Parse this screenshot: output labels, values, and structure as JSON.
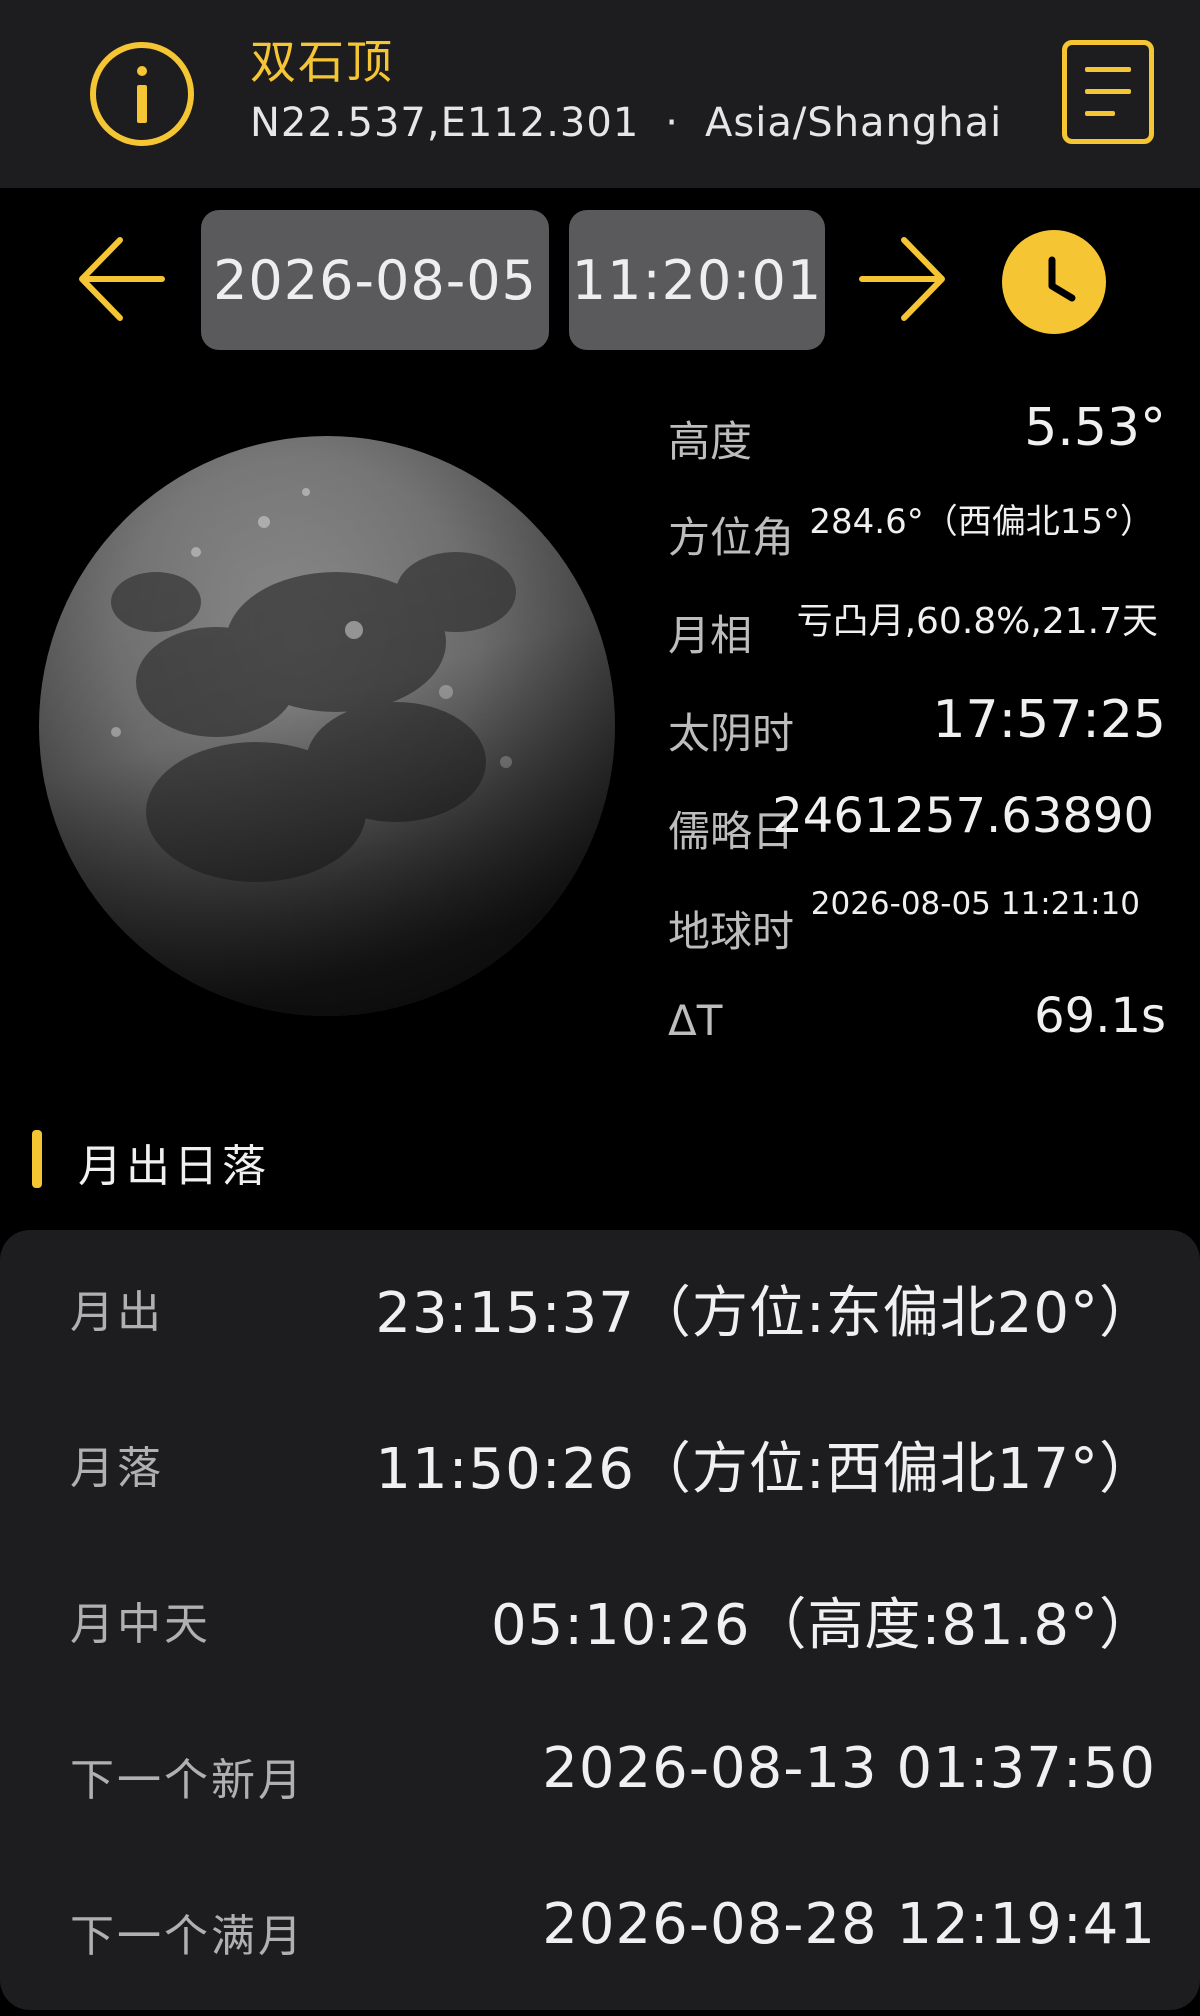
{
  "header": {
    "title": "双石顶",
    "coordinates": "N22.537,E112.301",
    "separator": "·",
    "timezone": "Asia/Shanghai"
  },
  "navigation": {
    "date": "2026-08-05",
    "time": "11:20:01"
  },
  "moon_params": [
    {
      "label": "高度",
      "value": "5.53°"
    },
    {
      "label": "方位角",
      "value": "284.6°（西偏北15°）"
    },
    {
      "label": "月相",
      "value": "亏凸月,60.8%,21.7天"
    },
    {
      "label": "太阴时",
      "value": "17:57:25"
    },
    {
      "label": "儒略日",
      "value": "2461257.63890"
    },
    {
      "label": "地球时",
      "value": "2026-08-05 11:21:10"
    },
    {
      "label": "ΔT",
      "value": "69.1s"
    }
  ],
  "section": {
    "title": "月出日落"
  },
  "events": [
    {
      "label": "月出",
      "value": "23:15:37（方位:东偏北20°）"
    },
    {
      "label": "月落",
      "value": "11:50:26（方位:西偏北17°）"
    },
    {
      "label": "月中天",
      "value": "05:10:26（高度:81.8°）"
    },
    {
      "label": "下一个新月",
      "value": "2026-08-13 01:37:50"
    },
    {
      "label": "下一个满月",
      "value": "2026-08-28 12:19:41"
    }
  ],
  "colors": {
    "accent": "#f5c534",
    "header_bg": "#1d1d1f",
    "pill_bg": "#5a5a5c",
    "page_bg": "#000000"
  },
  "icons": {
    "info": "info-icon",
    "menu": "menu-list-icon",
    "prev": "arrow-left-icon",
    "next": "arrow-right-icon",
    "clock": "clock-icon"
  }
}
